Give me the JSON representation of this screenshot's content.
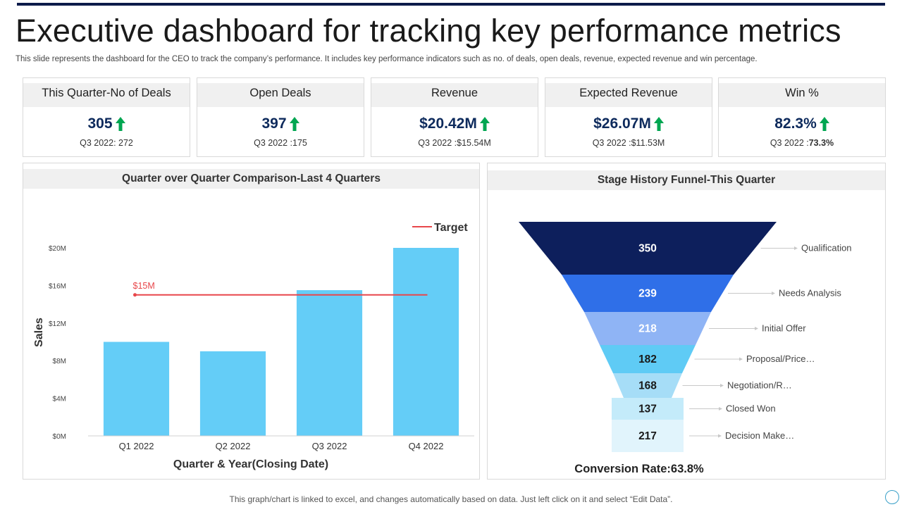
{
  "title": "Executive dashboard for tracking key performance metrics",
  "subtitle": "This slide represents the dashboard for the CEO to track the company’s performance. It includes key performance indicators such as no. of deals, open deals, revenue, expected revenue and win percentage.",
  "kpis": [
    {
      "label": "This Quarter-No of Deals",
      "value": "305",
      "compare": "Q3 2022:  272",
      "compare_bold": ""
    },
    {
      "label": "Open Deals",
      "value": "397",
      "compare": "Q3 2022  :175",
      "compare_bold": ""
    },
    {
      "label": "Revenue",
      "value": "$20.42M",
      "compare": "Q3 2022  :$15.54M",
      "compare_bold": ""
    },
    {
      "label": "Expected Revenue",
      "value": "$26.07M",
      "compare": "Q3 2022  :$11.53M",
      "compare_bold": ""
    },
    {
      "label": "Win %",
      "value": "82.3%",
      "compare": "Q3 2022  :",
      "compare_bold": "73.3%"
    }
  ],
  "colors": {
    "arrow_up": "#00a651",
    "bar": "#64cdf7",
    "target": "#e8474b",
    "kpi_value": "#0d2a5c",
    "funnel": [
      "#0d1f5c",
      "#2f6fe8",
      "#8fb4f5",
      "#5fcbf5",
      "#a6ddf7",
      "#c4ebfa",
      "#e1f4fc"
    ]
  },
  "icons": {
    "kpi_trend": "arrow-up-icon"
  },
  "chart_data": [
    {
      "type": "bar",
      "title": "Quarter over Quarter Comparison-Last 4 Quarters",
      "categories": [
        "Q1 2022",
        "Q2 2022",
        "Q3 2022",
        "Q4 2022"
      ],
      "values": [
        10,
        9,
        15.5,
        20
      ],
      "xlabel": "Quarter & Year(Closing Date)",
      "ylabel": "Sales",
      "ylim": [
        0,
        20
      ],
      "yticks": [
        0,
        4,
        8,
        12,
        16,
        20
      ],
      "ytick_labels": [
        "$0M",
        "$4M",
        "$8M",
        "$12M",
        "$16M",
        "$20M"
      ],
      "target": {
        "name": "Target",
        "value": 15,
        "label": "$15M"
      },
      "legend": "top-right",
      "grid": false
    },
    {
      "type": "funnel",
      "title": "Stage History Funnel-This Quarter",
      "stages": [
        {
          "name": "Qualification",
          "value": 350
        },
        {
          "name": "Needs Analysis",
          "value": 239
        },
        {
          "name": "Initial Offer",
          "value": 218
        },
        {
          "name": "Proposal/Price…",
          "value": 182
        },
        {
          "name": "Negotiation/R…",
          "value": 168
        },
        {
          "name": "Closed Won",
          "value": 137
        },
        {
          "name": "Decision Make…",
          "value": 217
        }
      ],
      "conversion_rate": "Conversion Rate:63.8%"
    }
  ],
  "footer": "This graph/chart is linked to excel, and changes automatically based on data. Just left click on it and select “Edit Data”."
}
